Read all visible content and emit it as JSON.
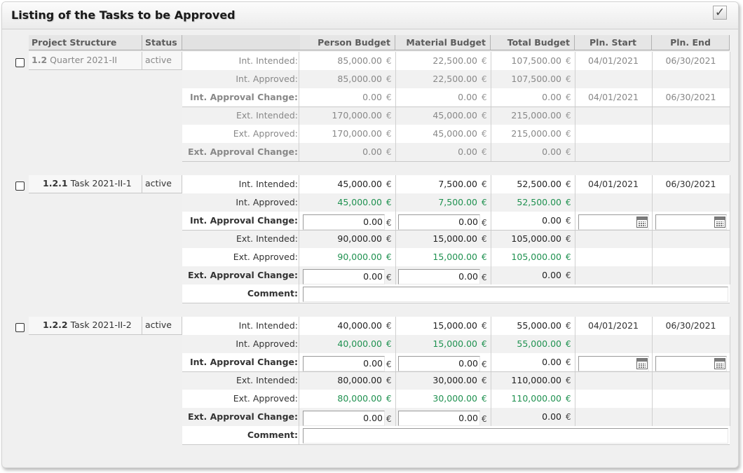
{
  "title": "Listing of the Tasks to be Approved",
  "confirm_icon": "✓",
  "headers": {
    "project_structure": "Project Structure",
    "status": "Status",
    "person_budget": "Person Budget",
    "material_budget": "Material Budget",
    "total_budget": "Total Budget",
    "pln_start": "Pln. Start",
    "pln_end": "Pln. End"
  },
  "currency": "€",
  "labels": {
    "int_intended": "Int. Intended:",
    "int_approved": "Int. Approved:",
    "int_change": "Int. Approval Change:",
    "ext_intended": "Ext. Intended:",
    "ext_approved": "Ext. Approved:",
    "ext_change": "Ext. Approval Change:",
    "comment": "Comment:"
  },
  "groups": [
    {
      "number": "1.2",
      "name": "Quarter 2021-II",
      "status": "active",
      "readonly": true,
      "rows": {
        "int_intended": {
          "person": "85,000.00",
          "material": "22,500.00",
          "total": "107,500.00",
          "start": "04/01/2021",
          "end": "06/30/2021"
        },
        "int_approved": {
          "person": "85,000.00",
          "material": "22,500.00",
          "total": "107,500.00"
        },
        "int_change": {
          "person": "0.00",
          "material": "0.00",
          "total": "0.00",
          "start": "04/01/2021",
          "end": "06/30/2021"
        },
        "ext_intended": {
          "person": "170,000.00",
          "material": "45,000.00",
          "total": "215,000.00"
        },
        "ext_approved": {
          "person": "170,000.00",
          "material": "45,000.00",
          "total": "215,000.00"
        },
        "ext_change": {
          "person": "0.00",
          "material": "0.00",
          "total": "0.00"
        }
      }
    },
    {
      "number": "1.2.1",
      "name": "Task 2021-II-1",
      "status": "active",
      "readonly": false,
      "rows": {
        "int_intended": {
          "person": "45,000.00",
          "material": "7,500.00",
          "total": "52,500.00",
          "start": "04/01/2021",
          "end": "06/30/2021"
        },
        "int_approved": {
          "person": "45,000.00",
          "material": "7,500.00",
          "total": "52,500.00"
        },
        "int_change": {
          "person": "0.00",
          "material": "0.00",
          "total": "0.00",
          "start": "",
          "end": ""
        },
        "ext_intended": {
          "person": "90,000.00",
          "material": "15,000.00",
          "total": "105,000.00"
        },
        "ext_approved": {
          "person": "90,000.00",
          "material": "15,000.00",
          "total": "105,000.00"
        },
        "ext_change": {
          "person": "0.00",
          "material": "0.00",
          "total": "0.00"
        }
      },
      "comment": ""
    },
    {
      "number": "1.2.2",
      "name": "Task 2021-II-2",
      "status": "active",
      "readonly": false,
      "rows": {
        "int_intended": {
          "person": "40,000.00",
          "material": "15,000.00",
          "total": "55,000.00",
          "start": "04/01/2021",
          "end": "06/30/2021"
        },
        "int_approved": {
          "person": "40,000.00",
          "material": "15,000.00",
          "total": "55,000.00"
        },
        "int_change": {
          "person": "0.00",
          "material": "0.00",
          "total": "0.00",
          "start": "",
          "end": ""
        },
        "ext_intended": {
          "person": "80,000.00",
          "material": "30,000.00",
          "total": "110,000.00"
        },
        "ext_approved": {
          "person": "80,000.00",
          "material": "30,000.00",
          "total": "110,000.00"
        },
        "ext_change": {
          "person": "0.00",
          "material": "0.00",
          "total": "0.00"
        }
      },
      "comment": ""
    }
  ],
  "colors": {
    "approved_green": "#1f9150",
    "readonly_grey": "#888888"
  }
}
